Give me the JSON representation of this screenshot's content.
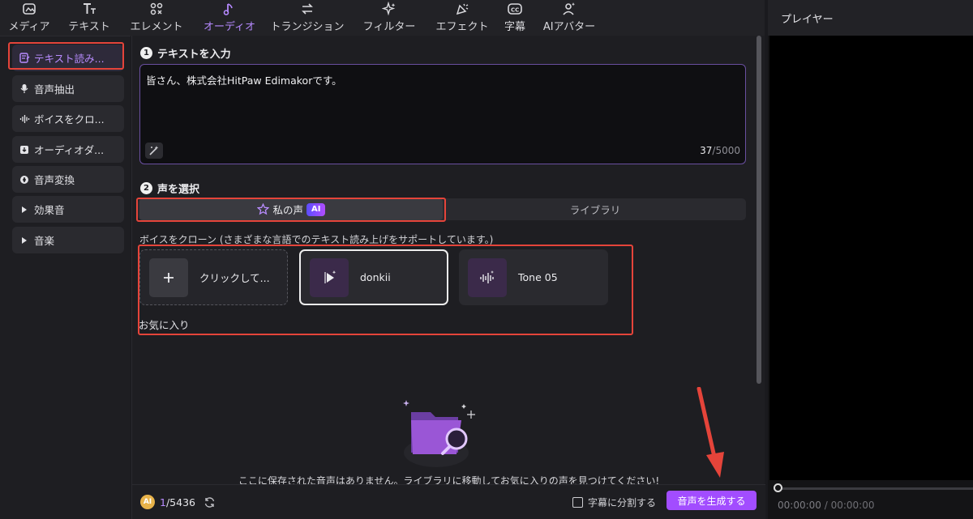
{
  "top_tabs": [
    {
      "label": "メディア",
      "icon": "media-icon"
    },
    {
      "label": "テキスト",
      "icon": "text-icon"
    },
    {
      "label": "エレメント",
      "icon": "element-icon"
    },
    {
      "label": "オーディオ",
      "icon": "audio-icon",
      "active": true
    },
    {
      "label": "トランジション",
      "icon": "transition-icon"
    },
    {
      "label": "フィルター",
      "icon": "filter-icon"
    },
    {
      "label": "エフェクト",
      "icon": "effect-icon"
    },
    {
      "label": "字幕",
      "icon": "subtitle-icon"
    },
    {
      "label": "AIアバター",
      "icon": "ai-avatar-icon"
    }
  ],
  "sidebar": {
    "items": [
      {
        "label": "テキスト読み...",
        "icon": "tts-icon",
        "active": true
      },
      {
        "label": "音声抽出",
        "icon": "mic-icon"
      },
      {
        "label": "ボイスをクロ...",
        "icon": "waveform-icon"
      },
      {
        "label": "オーディオダ...",
        "icon": "download-icon"
      },
      {
        "label": "音声変換",
        "icon": "voice-change-icon"
      },
      {
        "label": "効果音",
        "icon": "triangle-icon"
      },
      {
        "label": "音楽",
        "icon": "triangle-icon"
      }
    ]
  },
  "main": {
    "step1": {
      "num": "1",
      "title": "テキストを入力"
    },
    "text_input": {
      "value": "皆さん、株式会社HitPaw Edimakorです。",
      "count_current": "37",
      "count_max": "/5000"
    },
    "step2": {
      "num": "2",
      "title": "声を選択"
    },
    "voice_tabs": {
      "mine": "私の声",
      "ai_badge": "AI",
      "library": "ライブラリ"
    },
    "clone_hint": "ボイスをクローン (さまざまな言語でのテキスト読み上げをサポートしています。)",
    "voice_cards": [
      {
        "name": "クリックして...",
        "type": "add"
      },
      {
        "name": "donkii",
        "type": "voice",
        "selected": true
      },
      {
        "name": "Tone 05",
        "type": "voice"
      }
    ],
    "favorites_label": "お気に入り",
    "empty_message": "ここに保存された音声はありません。ライブラリに移動してお気に入りの声を見つけてください!"
  },
  "bottom": {
    "coin_label": "AI",
    "credits_used": "1",
    "credits_total": "/5436",
    "split_label": "字幕に分割する",
    "generate_button": "音声を生成する"
  },
  "player": {
    "title": "プレイヤー",
    "time_current": "00:00:00",
    "time_total": "/ 00:00:00"
  },
  "colors": {
    "accent": "#a24dff",
    "active_text": "#b589ff",
    "annotation_red": "#e5443a"
  }
}
